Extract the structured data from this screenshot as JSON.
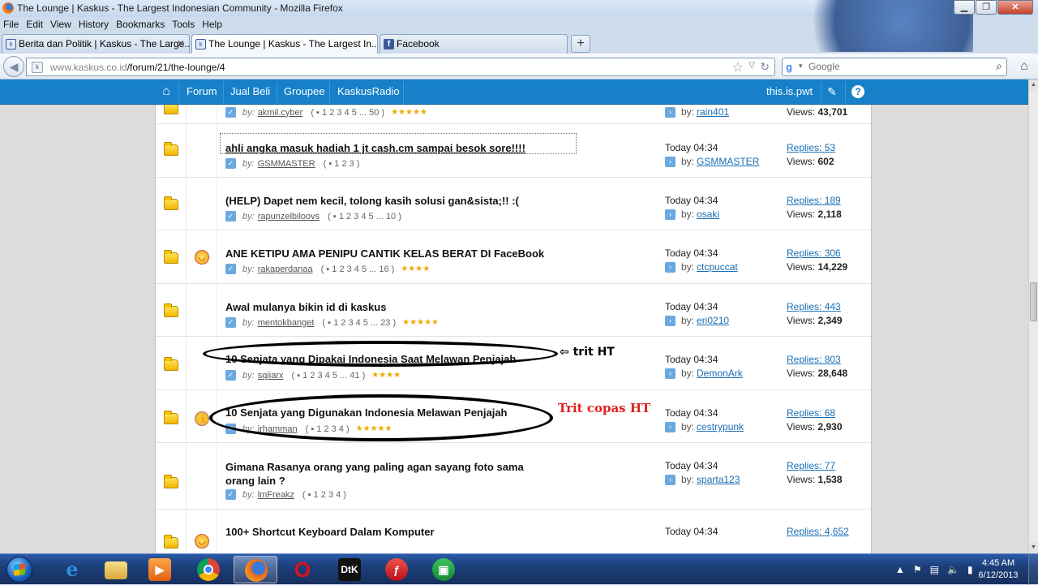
{
  "window": {
    "title": "The Lounge | Kaskus - The Largest Indonesian Community - Mozilla Firefox"
  },
  "menu": [
    "File",
    "Edit",
    "View",
    "History",
    "Bookmarks",
    "Tools",
    "Help"
  ],
  "tabs": [
    {
      "label": "Berita dan Politik | Kaskus - The Large...",
      "fav": "k"
    },
    {
      "label": "The Lounge | Kaskus - The Largest In...",
      "fav": "k"
    },
    {
      "label": "Facebook",
      "fav": "f"
    }
  ],
  "address": {
    "host": "www.kaskus.co.id",
    "path": "/forum/21/the-lounge/4"
  },
  "search": {
    "placeholder": "Google",
    "engine": "g"
  },
  "kaskus_nav": {
    "items": [
      "Forum",
      "Jual Beli",
      "Groupee",
      "KaskusRadio"
    ],
    "username": "this.is.pwt"
  },
  "threads": [
    {
      "title": "",
      "author": "akmil.cyber",
      "pages": "1  2  3  4  5 ... 50",
      "stars": "★★★★★",
      "last_time": "",
      "last_by": "rain401",
      "replies": "",
      "views": "43,701",
      "emo": ""
    },
    {
      "title": "ahli angka masuk hadiah 1 jt cash.cm sampai besok sore!!!!",
      "author": "GSMMASTER",
      "pages": "1  2  3",
      "stars": "",
      "last_time": "Today 04:34",
      "last_by": "GSMMASTER",
      "replies": "Replies: 53",
      "views": "602",
      "emo": ""
    },
    {
      "title": "(HELP) Dapet nem kecil, tolong kasih solusi gan&sista;!! :(",
      "author": "rapunzelbiloovs",
      "pages": "1  2  3  4  5 ... 10",
      "stars": "",
      "last_time": "Today 04:34",
      "last_by": "osaki",
      "replies": "Replies: 189",
      "views": "2,118",
      "emo": ""
    },
    {
      "title": "ANE KETIPU AMA PENIPU CANTIK KELAS BERAT DI FaceBook",
      "author": "rakaperdanaa",
      "pages": "1  2  3  4  5 ... 16",
      "stars": "★★★★",
      "last_time": "Today 04:34",
      "last_by": "ctcpuccat",
      "replies": "Replies: 306",
      "views": "14,229",
      "emo": "laugh"
    },
    {
      "title": "Awal mulanya bikin id di kaskus",
      "author": "mentokbanget",
      "pages": "1  2  3  4  5 ... 23",
      "stars": "★★★★★",
      "last_time": "Today 04:34",
      "last_by": "eri0210",
      "replies": "Replies: 443",
      "views": "2,349",
      "emo": ""
    },
    {
      "title": "10 Senjata yang Dipakai Indonesia Saat Melawan Penjajah",
      "author": "sqiiarx",
      "pages": "1  2  3  4  5 ... 41",
      "stars": "★★★★",
      "last_time": "Today 04:34",
      "last_by": "DemonArk",
      "replies": "Replies: 803",
      "views": "28,648",
      "emo": ""
    },
    {
      "title": "10 Senjata yang Digunakan Indonesia Melawan Penjajah",
      "author": "irhamman",
      "pages": "1  2  3  4",
      "stars": "★★★★★",
      "last_time": "Today 04:34",
      "last_by": "cestrypunk",
      "replies": "Replies: 68",
      "views": "2,930",
      "emo": "thumb"
    },
    {
      "title": "Gimana Rasanya orang yang paling agan sayang foto sama\norang lain ?",
      "author": "lmFreakz",
      "pages": "1  2  3  4",
      "stars": "",
      "last_time": "Today 04:34",
      "last_by": "sparta123",
      "replies": "Replies: 77",
      "views": "1,538",
      "emo": ""
    },
    {
      "title": "100+ Shortcut Keyboard Dalam Komputer",
      "author": "",
      "pages": "",
      "stars": "",
      "last_time": "Today 04:34",
      "last_by": "",
      "replies": "Replies: 4,652",
      "views": "",
      "emo": "laugh"
    }
  ],
  "labels": {
    "by": "by:",
    "views_prefix": "Views: "
  },
  "annotations": {
    "note1": "trit HT",
    "note2": "Trit copas HT"
  },
  "clock": {
    "time": "4:45 AM",
    "date": "6/12/2013"
  },
  "colors": {
    "kaskus_blue": "#1680c9",
    "annotation_red": "#e0201c"
  }
}
